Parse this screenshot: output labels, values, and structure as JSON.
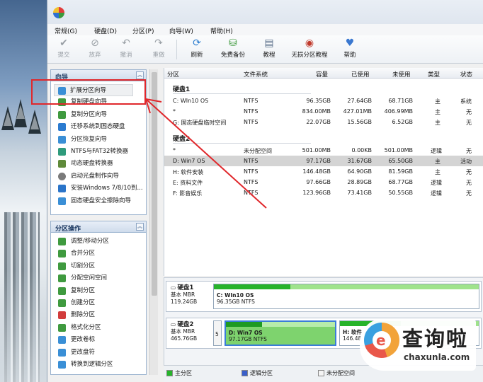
{
  "menu": [
    "常规(G)",
    "硬盘(D)",
    "分区(P)",
    "向导(W)",
    "帮助(H)"
  ],
  "toolbar": [
    {
      "label": "提交",
      "icon": "check-icon",
      "enabled": false
    },
    {
      "label": "放弃",
      "icon": "discard-icon",
      "enabled": false
    },
    {
      "label": "撤消",
      "icon": "undo-icon",
      "enabled": false
    },
    {
      "label": "重做",
      "icon": "redo-icon",
      "enabled": false
    },
    {
      "label": "刷新",
      "icon": "refresh-icon",
      "enabled": true
    },
    {
      "label": "免费备份",
      "icon": "backup-icon",
      "enabled": true
    },
    {
      "label": "教程",
      "icon": "tutorial-icon",
      "enabled": true
    },
    {
      "label": "无损分区教程",
      "icon": "lossless-partition-icon",
      "enabled": true
    },
    {
      "label": "帮助",
      "icon": "help-heart-icon",
      "enabled": true
    }
  ],
  "wizard_panel": {
    "title": "向导",
    "items": [
      {
        "label": "扩展分区向导",
        "color": "#3a8fd6"
      },
      {
        "label": "复制硬盘向导",
        "color": "#3f9a3f"
      },
      {
        "label": "复制分区向导",
        "color": "#3f9a3f"
      },
      {
        "label": "迁移系统到固态硬盘",
        "color": "#2b7bd0"
      },
      {
        "label": "分区恢复向导",
        "color": "#3a8fd6"
      },
      {
        "label": "NTFS与FAT32转换器",
        "color": "#2f9b7c"
      },
      {
        "label": "动态硬盘转换器",
        "color": "#5f8a3a"
      },
      {
        "label": "启动光盘制作向导",
        "color": "#7a7a7a"
      },
      {
        "label": "安装Windows 7/8/10到...",
        "color": "#2a74c9"
      },
      {
        "label": "固态硬盘安全擦除向导",
        "color": "#3a8fd6"
      }
    ]
  },
  "ops_panel": {
    "title": "分区操作",
    "items": [
      {
        "label": "调整/移动分区",
        "color": "#3f9a3f"
      },
      {
        "label": "合并分区",
        "color": "#3f9a3f"
      },
      {
        "label": "切割分区",
        "color": "#3f9a3f"
      },
      {
        "label": "分配空闲空间",
        "color": "#3f9a3f"
      },
      {
        "label": "复制分区",
        "color": "#3f9a3f"
      },
      {
        "label": "创建分区",
        "color": "#3f9a3f"
      },
      {
        "label": "删除分区",
        "color": "#d23c3c"
      },
      {
        "label": "格式化分区",
        "color": "#3f9a3f"
      },
      {
        "label": "更改卷标",
        "color": "#3a8fd6"
      },
      {
        "label": "更改盘符",
        "color": "#3a8fd6"
      },
      {
        "label": "转换到逻辑分区",
        "color": "#3a8fd6"
      }
    ]
  },
  "table": {
    "headers": [
      "分区",
      "文件系统",
      "容量",
      "已使用",
      "未使用",
      "类型",
      "状态"
    ],
    "groups": [
      {
        "name": "硬盘1",
        "rows": [
          {
            "part": "C: WIn10 OS",
            "fs": "NTFS",
            "cap": "96.35GB",
            "used": "27.64GB",
            "free": "68.71GB",
            "type": "主",
            "status": "系统",
            "selected": false
          },
          {
            "part": "*",
            "fs": "NTFS",
            "cap": "834.00MB",
            "used": "427.01MB",
            "free": "406.99MB",
            "type": "主",
            "status": "无",
            "selected": false
          },
          {
            "part": "G: 固态硬盘临时空间",
            "fs": "NTFS",
            "cap": "22.07GB",
            "used": "15.56GB",
            "free": "6.52GB",
            "type": "主",
            "status": "无",
            "selected": false
          }
        ]
      },
      {
        "name": "硬盘2",
        "rows": [
          {
            "part": "*",
            "fs": "未分配空间",
            "cap": "501.00MB",
            "used": "0.00KB",
            "free": "501.00MB",
            "type": "逻辑",
            "status": "无",
            "selected": false
          },
          {
            "part": "D: Win7 OS",
            "fs": "NTFS",
            "cap": "97.17GB",
            "used": "31.67GB",
            "free": "65.50GB",
            "type": "主",
            "status": "活动",
            "selected": true
          },
          {
            "part": "H: 软件安装",
            "fs": "NTFS",
            "cap": "146.48GB",
            "used": "64.90GB",
            "free": "81.59GB",
            "type": "主",
            "status": "无",
            "selected": false
          },
          {
            "part": "E: 资料文件",
            "fs": "NTFS",
            "cap": "97.66GB",
            "used": "28.89GB",
            "free": "68.77GB",
            "type": "逻辑",
            "status": "无",
            "selected": false
          },
          {
            "part": "F: 影音娱乐",
            "fs": "NTFS",
            "cap": "123.96GB",
            "used": "73.41GB",
            "free": "50.55GB",
            "type": "逻辑",
            "status": "无",
            "selected": false
          }
        ]
      }
    ]
  },
  "disk_map": [
    {
      "name": "硬盘1",
      "style": "基本 MBR",
      "size": "119.24GB",
      "parts": [
        {
          "name": "C: WIn10 OS",
          "detail": "96.35GB NTFS",
          "used_fraction": 0.29,
          "selected": false
        }
      ]
    },
    {
      "name": "硬盘2",
      "style": "基本 MBR",
      "size": "465.76GB",
      "prefix": "5",
      "parts": [
        {
          "name": "D: Win7 OS",
          "detail": "97.17GB NTFS",
          "used_fraction": 0.33,
          "selected": true
        },
        {
          "name": "H: 软件",
          "detail": "146.48",
          "used_fraction": 0.44,
          "selected": false
        }
      ]
    }
  ],
  "legend": [
    {
      "label": "主分区",
      "color": "#27b32a"
    },
    {
      "label": "逻辑分区",
      "color": "#3a5fc9"
    },
    {
      "label": "未分配空间",
      "color": "#f4f4f4"
    }
  ],
  "watermark": {
    "cn": "查询啦",
    "en": "chaxunla.com",
    "logo_letter": "e"
  },
  "annotation_color": "#e0282c"
}
